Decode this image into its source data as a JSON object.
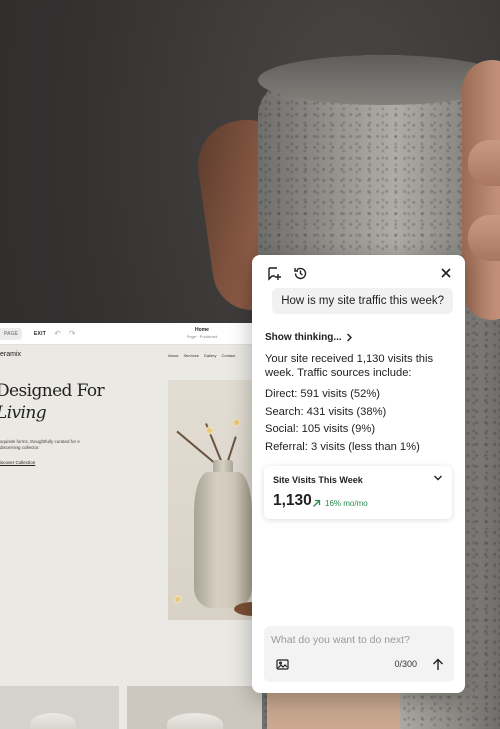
{
  "colors": {
    "accent_green": "#2b8a4f",
    "panel_bg": "#ffffff",
    "bubble_bg": "#f1f1f1"
  },
  "editor": {
    "page_chip": "PAGE",
    "exit_label": "EXIT",
    "undo_icon": "undo-icon",
    "redo_icon": "redo-icon",
    "page_title": "Home",
    "page_status": "Page · Published"
  },
  "site": {
    "brand": "eramix",
    "nav": [
      "About",
      "Services",
      "Gallery",
      "Contact"
    ],
    "hero_title_line1": "Designed For",
    "hero_title_line2": "Living",
    "hero_sub": "xquisite forms, thoughtfully curated for e discerning collector.",
    "hero_link": "iscover Collection"
  },
  "assistant": {
    "new_chat_icon": "add-chat-icon",
    "history_icon": "history-icon",
    "close_icon": "close-icon",
    "user_message": "How is my site traffic this week?",
    "thinking_label": "Show thinking...",
    "answer_intro": "Your site received 1,130 visits this week. Traffic sources include:",
    "sources": [
      "Direct: 591 visits (52%)",
      "Search: 431 visits (38%)",
      "Social: 105 visits (9%)",
      "Referral: 3 visits (less than 1%)"
    ],
    "card": {
      "title": "Site Visits This Week",
      "value": "1,130",
      "delta": "16% mo/mo"
    },
    "composer": {
      "placeholder": "What do you want to do next?",
      "counter": "0/300"
    }
  }
}
